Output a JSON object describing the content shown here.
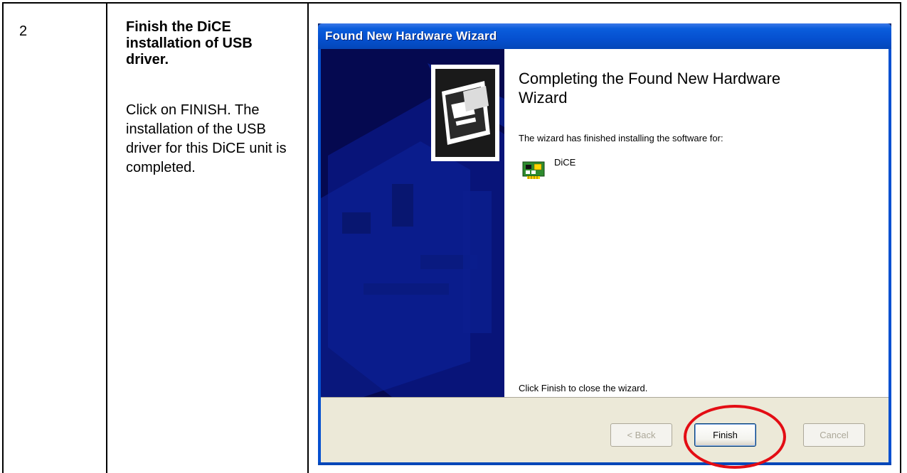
{
  "step": {
    "number": "2",
    "title": "Finish the DiCE installation of USB driver.",
    "description": "Click on FINISH. The installation of the USB driver for this DiCE unit is completed."
  },
  "wizard": {
    "window_title": "Found New Hardware Wizard",
    "heading": "Completing the Found New Hardware Wizard",
    "subtext": "The wizard has finished installing the software for:",
    "device_name": "DiCE",
    "close_instruction": "Click Finish to close the wizard.",
    "buttons": {
      "back": "< Back",
      "finish": "Finish",
      "cancel": "Cancel"
    }
  },
  "colors": {
    "titlebar": "#0550d0",
    "side_panel": "#050950",
    "highlight": "#e30d14",
    "button_bar": "#ece9d8"
  }
}
